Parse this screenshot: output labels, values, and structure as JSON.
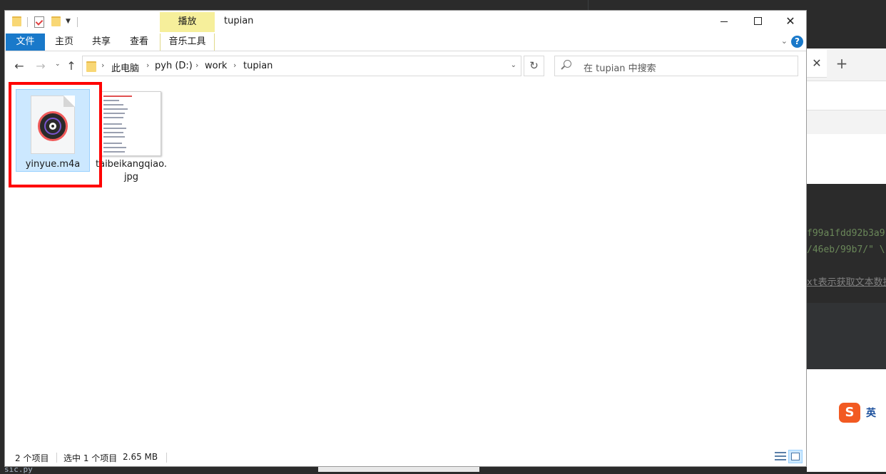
{
  "window": {
    "title": "tupian",
    "context_group": "播放",
    "minimize_glyph": "—",
    "maximize_glyph": "☐",
    "close_glyph": "✕"
  },
  "ribbon": {
    "tabs": [
      "文件",
      "主页",
      "共享",
      "查看",
      "音乐工具"
    ],
    "expand_glyph": "⌄",
    "help_glyph": "?"
  },
  "navigation": {
    "back_glyph": "←",
    "forward_glyph": "→",
    "recent_glyph": "⌄",
    "up_glyph": "↑",
    "breadcrumb": [
      "此电脑",
      "pyh (D:)",
      "work",
      "tupian"
    ],
    "separator": "›",
    "refresh_glyph": "↻",
    "address_dropdown_glyph": "⌄"
  },
  "search": {
    "placeholder": "在 tupian 中搜索"
  },
  "files": [
    {
      "name": "yinyue.m4a",
      "icon": "music-file-icon",
      "selected": true
    },
    {
      "name_line1": "taibeikangqiao.",
      "name_line2": "jpg",
      "icon": "image-thumbnail",
      "selected": false
    }
  ],
  "status": {
    "item_count": "2 个项目",
    "selection": "选中 1 个项目",
    "size": "2.65 MB"
  },
  "background": {
    "browser_tab_close": "✕",
    "browser_new_tab": "+",
    "code_lines": [
      "f99a1fdd92b3a9",
      "/46eb/99b7/\" \\",
      "xt表示获取文本数据"
    ],
    "ime_logo": "S",
    "ime_mode": "英",
    "bottom_code": "sic.py"
  },
  "colors": {
    "file_tab": "#1979ca",
    "context_tab": "#f6ef9b",
    "selection": "#cce8ff",
    "highlight": "#ff0000",
    "code_green": "#6a8759",
    "code_gray": "#a9b7c6"
  }
}
